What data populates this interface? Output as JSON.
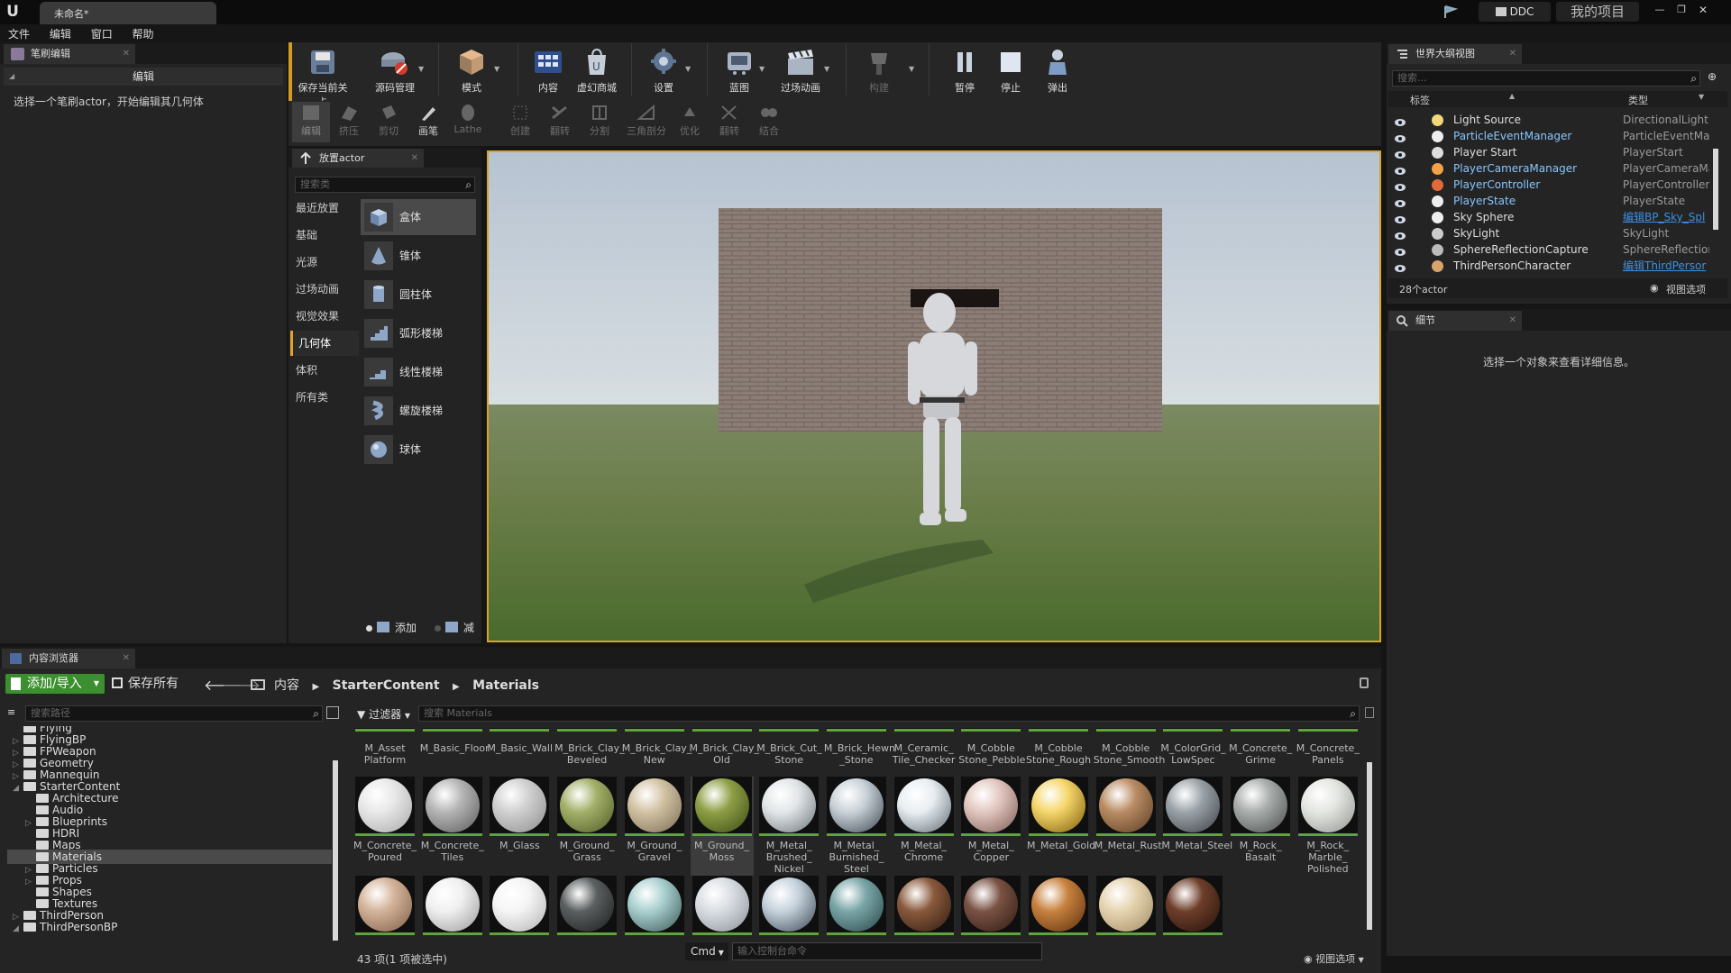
{
  "window": {
    "tab_title": "未命名*",
    "ddc_label": "DDC",
    "project_label": "我的项目"
  },
  "menu": [
    "文件",
    "编辑",
    "窗口",
    "帮助"
  ],
  "brush_panel": {
    "tab": "笔刷编辑",
    "section": "编辑",
    "hint": "选择一个笔刷actor，开始编辑其几何体"
  },
  "toolbar": [
    {
      "label": "保存当前关卡",
      "icon": "save-icon"
    },
    {
      "label": "源码管理",
      "icon": "source-control-icon"
    },
    {
      "label": "模式",
      "icon": "modes-icon"
    },
    {
      "label": "内容",
      "icon": "content-icon"
    },
    {
      "label": "虚幻商城",
      "icon": "marketplace-icon"
    },
    {
      "label": "设置",
      "icon": "settings-icon"
    },
    {
      "label": "蓝图",
      "icon": "blueprint-icon"
    },
    {
      "label": "过场动画",
      "icon": "cinematics-icon"
    },
    {
      "label": "构建",
      "icon": "build-icon"
    },
    {
      "label": "暂停",
      "icon": "pause-icon"
    },
    {
      "label": "停止",
      "icon": "stop-icon"
    },
    {
      "label": "弹出",
      "icon": "eject-icon"
    }
  ],
  "brush_modes": [
    "编辑",
    "挤压",
    "剪切",
    "画笔",
    "Lathe",
    "创建",
    "翻转",
    "分割",
    "三角剖分",
    "优化",
    "翻转",
    "结合"
  ],
  "place_actor": {
    "tab": "放置actor",
    "search_placeholder": "搜索类",
    "categories": [
      "最近放置",
      "基础",
      "光源",
      "过场动画",
      "视觉效果",
      "几何体",
      "体积",
      "所有类"
    ],
    "selected_category": "几何体",
    "items": [
      "盒体",
      "锥体",
      "圆柱体",
      "弧形楼梯",
      "线性楼梯",
      "螺旋楼梯",
      "球体"
    ],
    "add_label": "添加",
    "subtract_label": "减"
  },
  "outliner": {
    "tab": "世界大纲视图",
    "search_placeholder": "搜索...",
    "col_label": "标签",
    "col_type": "类型",
    "rows": [
      {
        "name": "Light Source",
        "type": "DirectionalLight",
        "link": false,
        "hl": false,
        "color": "#f2d77a"
      },
      {
        "name": "ParticleEventManager",
        "type": "ParticleEventMan",
        "link": false,
        "hl": true,
        "color": "#eeeeee"
      },
      {
        "name": "Player Start",
        "type": "PlayerStart",
        "link": false,
        "hl": false,
        "color": "#dddddd"
      },
      {
        "name": "PlayerCameraManager",
        "type": "PlayerCameraMar",
        "link": false,
        "hl": true,
        "color": "#f0a34a"
      },
      {
        "name": "PlayerController",
        "type": "PlayerController",
        "link": false,
        "hl": true,
        "color": "#e06a3b"
      },
      {
        "name": "PlayerState",
        "type": "PlayerState",
        "link": false,
        "hl": true,
        "color": "#eeeeee"
      },
      {
        "name": "Sky Sphere",
        "type": "编辑BP_Sky_Spl",
        "link": true,
        "hl": false,
        "color": "#eeeeee"
      },
      {
        "name": "SkyLight",
        "type": "SkyLight",
        "link": false,
        "hl": false,
        "color": "#cccccc"
      },
      {
        "name": "SphereReflectionCapture",
        "type": "SphereReflectionC",
        "link": false,
        "hl": false,
        "color": "#bbbbbb"
      },
      {
        "name": "ThirdPersonCharacter",
        "type": "编辑ThirdPersor",
        "link": true,
        "hl": false,
        "color": "#d9a46a"
      }
    ],
    "count": "28个actor",
    "view_options": "视图选项"
  },
  "details": {
    "tab": "细节",
    "hint": "选择一个对象来查看详细信息。"
  },
  "content_browser": {
    "tab": "内容浏览器",
    "add_import": "添加/导入",
    "save_all": "保存所有",
    "breadcrumb": [
      "内容",
      "StarterContent",
      "Materials"
    ],
    "path_search_placeholder": "搜索路径",
    "filter_label": "过滤器",
    "asset_search_placeholder": "搜索 Materials",
    "tree": [
      {
        "label": "Flying",
        "indent": 0,
        "arrow": ""
      },
      {
        "label": "FlyingBP",
        "indent": 0,
        "arrow": "▷"
      },
      {
        "label": "FPWeapon",
        "indent": 0,
        "arrow": "▷"
      },
      {
        "label": "Geometry",
        "indent": 0,
        "arrow": "▷"
      },
      {
        "label": "Mannequin",
        "indent": 0,
        "arrow": "▷"
      },
      {
        "label": "StarterContent",
        "indent": 0,
        "arrow": "◢"
      },
      {
        "label": "Architecture",
        "indent": 1,
        "arrow": ""
      },
      {
        "label": "Audio",
        "indent": 1,
        "arrow": ""
      },
      {
        "label": "Blueprints",
        "indent": 1,
        "arrow": "▷"
      },
      {
        "label": "HDRI",
        "indent": 1,
        "arrow": ""
      },
      {
        "label": "Maps",
        "indent": 1,
        "arrow": ""
      },
      {
        "label": "Materials",
        "indent": 1,
        "arrow": ""
      },
      {
        "label": "Particles",
        "indent": 1,
        "arrow": "▷"
      },
      {
        "label": "Props",
        "indent": 1,
        "arrow": "▷"
      },
      {
        "label": "Shapes",
        "indent": 1,
        "arrow": ""
      },
      {
        "label": "Textures",
        "indent": 1,
        "arrow": ""
      },
      {
        "label": "ThirdPerson",
        "indent": 0,
        "arrow": "▷"
      },
      {
        "label": "ThirdPersonBP",
        "indent": 0,
        "arrow": "◢"
      }
    ],
    "row1_labels": [
      "M_Asset\nPlatform",
      "M_Basic_Floor",
      "M_Basic_Wall",
      "M_Brick_Clay_\nBeveled",
      "M_Brick_Clay_\nNew",
      "M_Brick_Clay_\nOld",
      "M_Brick_Cut_\nStone",
      "M_Brick_Hewn\n_Stone",
      "M_Ceramic_\nTile_Checker",
      "M_Cobble\nStone_Pebble",
      "M_Cobble\nStone_Rough",
      "M_Cobble\nStone_Smooth",
      "M_ColorGrid_\nLowSpec",
      "M_Concrete_\nGrime",
      "M_Concrete_\nPanels"
    ],
    "row2": [
      {
        "label": "M_Concrete_\nPoured",
        "color": "#e8e8e8",
        "dark": "#a8a8a8"
      },
      {
        "label": "M_Concrete_\nTiles",
        "color": "#b5b5b5",
        "dark": "#5a5a5a"
      },
      {
        "label": "M_Glass",
        "color": "#d0d0d0",
        "dark": "#8c8c8c"
      },
      {
        "label": "M_Ground_\nGrass",
        "color": "#a3b06a",
        "dark": "#4d5a22"
      },
      {
        "label": "M_Ground_\nGravel",
        "color": "#d2c2a4",
        "dark": "#7a6b52"
      },
      {
        "label": "M_Ground_\nMoss",
        "color": "#8e9f45",
        "dark": "#3b4a16"
      },
      {
        "label": "M_Metal_\nBrushed_\nNickel",
        "color": "#e2e6e8",
        "dark": "#6b7479"
      },
      {
        "label": "M_Metal_\nBurnished_\nSteel",
        "color": "#c9d2d8",
        "dark": "#3c4650"
      },
      {
        "label": "M_Metal_\nChrome",
        "color": "#e8eef2",
        "dark": "#606a72"
      },
      {
        "label": "M_Metal_\nCopper",
        "color": "#e2c7c0",
        "dark": "#7b5a52"
      },
      {
        "label": "M_Metal_Gold",
        "color": "#f5d66b",
        "dark": "#7a5a06"
      },
      {
        "label": "M_Metal_Rust",
        "color": "#b98c63",
        "dark": "#5a3a22"
      },
      {
        "label": "M_Metal_Steel",
        "color": "#9ca3a8",
        "dark": "#3a3f44"
      },
      {
        "label": "M_Rock_\nBasalt",
        "color": "#a9adab",
        "dark": "#474b4a"
      },
      {
        "label": "M_Rock_\nMarble_\nPolished",
        "color": "#e4e6e2",
        "dark": "#8f938e"
      }
    ],
    "row3": [
      {
        "color": "#d3b399",
        "dark": "#7d5c44"
      },
      {
        "color": "#f0f0f0",
        "dark": "#9a9a9a"
      },
      {
        "color": "#f5f5f5",
        "dark": "#b3b3b3"
      },
      {
        "color": "#5a5f5f",
        "dark": "#1a1c1c"
      },
      {
        "color": "#a9d0cf",
        "dark": "#3a5656"
      },
      {
        "color": "#d9dee3",
        "dark": "#8a9098"
      },
      {
        "color": "#c6d2dc",
        "dark": "#3a4652"
      },
      {
        "color": "#7aa6a8",
        "dark": "#264547"
      },
      {
        "color": "#8a5a3c",
        "dark": "#2d1a10"
      },
      {
        "color": "#7a5244",
        "dark": "#2e1a12"
      },
      {
        "color": "#c7813e",
        "dark": "#5a2e0c"
      },
      {
        "color": "#e6d4b0",
        "dark": "#a08c66"
      },
      {
        "color": "#6e3e2a",
        "dark": "#24120a"
      }
    ],
    "status": "43 项(1 项被选中)",
    "cmd_label": "Cmd",
    "console_placeholder": "输入控制台命令",
    "view_options": "视图选项"
  }
}
